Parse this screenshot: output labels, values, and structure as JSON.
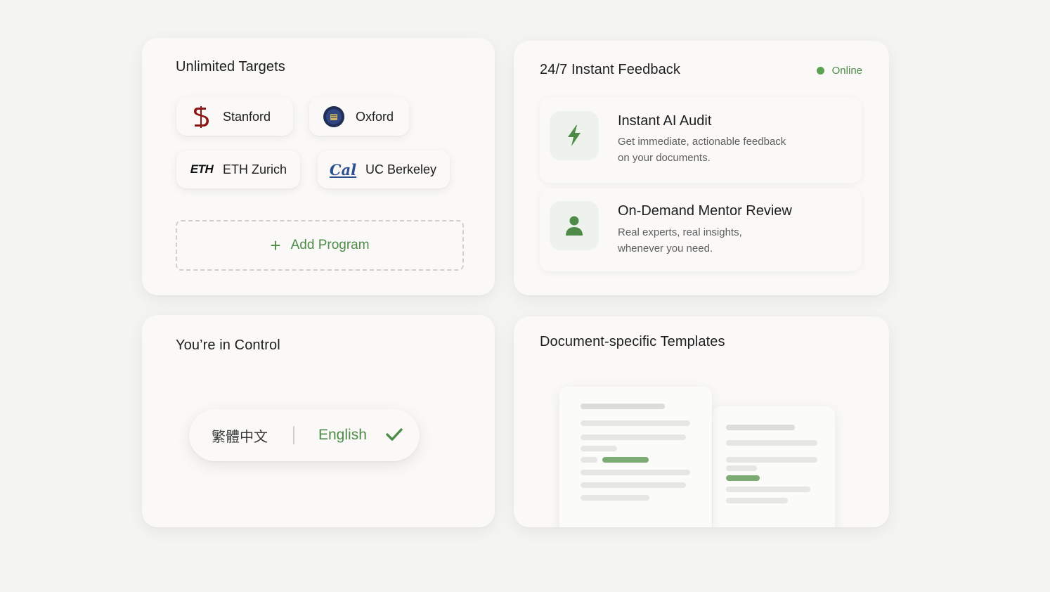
{
  "targets": {
    "title": "Unlimited Targets",
    "schools": [
      {
        "name": "Stanford",
        "logo": "stanford-logo"
      },
      {
        "name": "Oxford",
        "logo": "oxford-logo"
      },
      {
        "name": "ETH Zurich",
        "logo": "eth-logo",
        "logo_text": "ETH"
      },
      {
        "name": "UC Berkeley",
        "logo": "cal-logo",
        "logo_text": "Cal"
      }
    ],
    "add_label": "Add Program"
  },
  "feedback": {
    "title": "24/7 Instant Feedback",
    "status": "Online",
    "status_color": "#5aa24f",
    "features": [
      {
        "title": "Instant AI Audit",
        "desc_line1": "Get immediate, actionable feedback",
        "desc_line2": "on your documents.",
        "icon": "lightning-icon"
      },
      {
        "title": "On-Demand Mentor Review",
        "desc_line1": "Real experts, real insights,",
        "desc_line2": "whenever you need.",
        "icon": "person-icon"
      }
    ]
  },
  "control": {
    "title": "You’re in Control",
    "options": [
      "繁體中文",
      "English"
    ],
    "selected": "English"
  },
  "templates": {
    "title": "Document-specific Templates"
  },
  "colors": {
    "accent": "#4e8a48",
    "stanford": "#8c1515",
    "berkeley": "#2d4f8f"
  }
}
